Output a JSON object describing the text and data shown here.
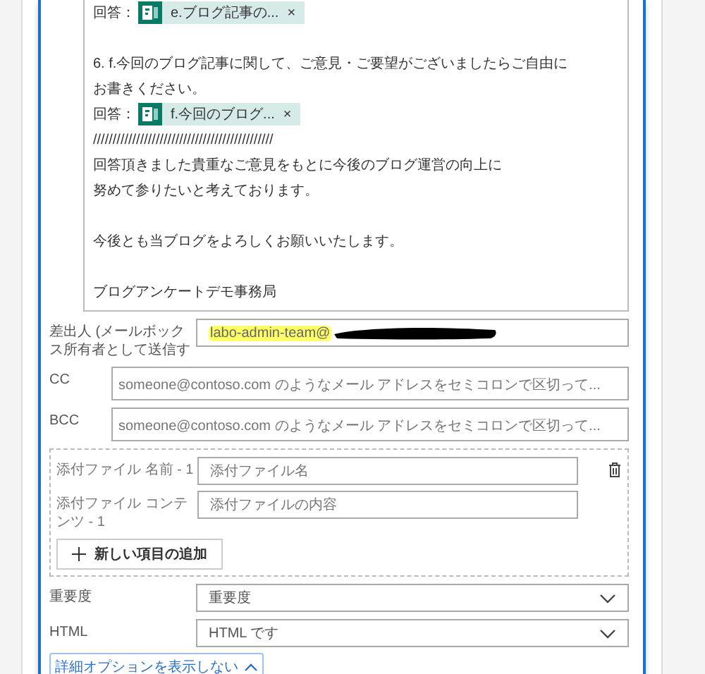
{
  "body": [
    {
      "kind": "answer",
      "label": "回答：",
      "chip": "e.ブログ記事の...",
      "remove": "×"
    },
    {
      "kind": "blank"
    },
    {
      "kind": "text",
      "text": "6. f.今回のブログ記事に関して、ご意見・ご要望がございましたらご自由に"
    },
    {
      "kind": "text",
      "text": "お書きください。"
    },
    {
      "kind": "answer",
      "label": "回答：",
      "chip": "f.今回のブログ...",
      "remove": "×"
    },
    {
      "kind": "text",
      "text": "//////////////////////////////////////////////"
    },
    {
      "kind": "text",
      "text": "回答頂きました貴重なご意見をもとに今後のブログ運営の向上に"
    },
    {
      "kind": "text",
      "text": "努めて参りたいと考えております。"
    },
    {
      "kind": "blank"
    },
    {
      "kind": "text",
      "text": "今後とも当ブログをよろしくお願いいたします。"
    },
    {
      "kind": "blank"
    },
    {
      "kind": "text",
      "text": "ブログアンケートデモ事務局"
    }
  ],
  "from": {
    "label": "差出人 (メールボックス所有者として送信す",
    "value": "labo-admin-team@"
  },
  "cc": {
    "label": "CC",
    "placeholder": "someone@contoso.com のようなメール アドレスをセミコロンで区切って..."
  },
  "bcc": {
    "label": "BCC",
    "placeholder": "someone@contoso.com のようなメール アドレスをセミコロンで区切って..."
  },
  "attachment": {
    "name_label": "添付ファイル 名前 - 1",
    "name_placeholder": "添付ファイル名",
    "content_label": "添付ファイル コンテンツ - 1",
    "content_placeholder": "添付ファイルの内容",
    "add_button": "新しい項目の追加"
  },
  "importance": {
    "label": "重要度",
    "value": "重要度"
  },
  "html": {
    "label": "HTML",
    "value": "HTML です"
  },
  "options_button": "詳細オプションを表示しない"
}
